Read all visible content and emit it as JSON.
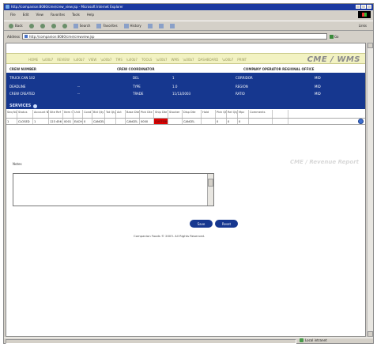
{
  "browser": {
    "title": "http://companion:8080/cme/crew_view.jsp - Microsoft Internet Explorer",
    "menu": [
      "File",
      "Edit",
      "View",
      "Favorites",
      "Tools",
      "Help"
    ],
    "toolbar": {
      "back": "Back",
      "search": "Search",
      "favorites": "Favorites",
      "history": "History",
      "links": "Links"
    },
    "address_label": "Address",
    "address_value": "http://companion:8080/cme/crewview.jsp",
    "go_label": "Go",
    "status": "Local intranet"
  },
  "site": {
    "brand": "CME / WMS",
    "nav": [
      "HOME",
      "REVIEW",
      "VIEW",
      "TMS",
      "TOOLS",
      "WMS",
      "DASHBOARD",
      "PRINT"
    ]
  },
  "info_header": {
    "c1": "CREW  NUMBER",
    "c2": "CREW  COORDINATOR",
    "c3": "COMPANY  OPERATOR  REGIONAL  OFFICE"
  },
  "blue": {
    "r1a": "TRUCK CAN 102",
    "r1b": "DEL",
    "r1c": "1",
    "r1d": "CORRIDOR",
    "r1e": "MID",
    "r2a": "DEADLINE",
    "r2b": "--",
    "r2c": "TYPE",
    "r2d": "1.0",
    "r2e": "REGION",
    "r2f": "MID",
    "r3a": "CREW CREATED",
    "r3b": "--",
    "r3c": "TRADE",
    "r3d": "11/13/2003",
    "r3e": "RATIO",
    "r3f": "MID",
    "services": "SERVICES"
  },
  "table": {
    "headers": [
      "Seq No",
      "Status",
      "Account No",
      "Site Ref",
      "Item Qty",
      "Unit",
      "Cond",
      "Bld Qty",
      "Tot Qty",
      "Act",
      "Base Dte",
      "Pick Dte",
      "Ship Dte",
      "Stocker",
      "Disp Dte",
      "Hold",
      "Pick Qty",
      "Rel Qty",
      "Mpc",
      "Comments",
      ""
    ],
    "row": [
      "1",
      "CLOSED",
      "1",
      "123 456",
      "0001",
      "EACH",
      "0",
      "CANCEL",
      "",
      "",
      "CANCEL",
      "0000",
      "CUSTOM",
      "",
      "CANCEL",
      "",
      "0",
      "0",
      "0",
      "",
      ""
    ]
  },
  "notes": {
    "label": "Notes",
    "value": ""
  },
  "watermark": "CME / Revenue Report",
  "buttons": {
    "save": "Save",
    "reset": "Reset"
  },
  "copyright": "Companion Foods © 2003. All Rights Reserved."
}
